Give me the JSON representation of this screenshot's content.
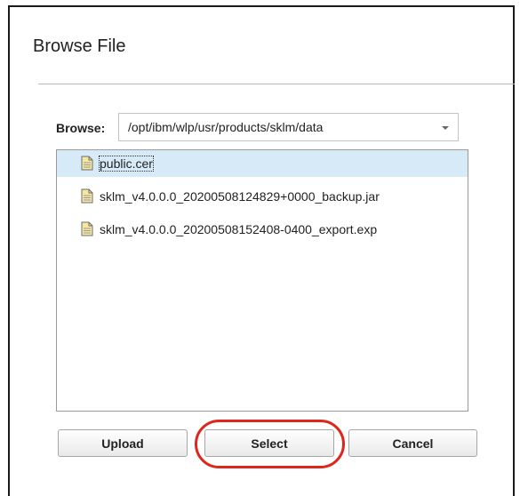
{
  "dialog": {
    "title": "Browse File",
    "browse_label": "Browse:",
    "browse_path": "/opt/ibm/wlp/usr/products/sklm/data",
    "files": [
      {
        "name": "public.cer",
        "selected": true
      },
      {
        "name": "sklm_v4.0.0.0_20200508124829+0000_backup.jar",
        "selected": false
      },
      {
        "name": "sklm_v4.0.0.0_20200508152408-0400_export.exp",
        "selected": false
      }
    ],
    "buttons": {
      "upload": "Upload",
      "select": "Select",
      "cancel": "Cancel"
    }
  },
  "icons": {
    "file": "document-icon",
    "dropdown": "chevron-down-icon"
  },
  "colors": {
    "selection": "#d7eaf7",
    "highlight_ring": "#e0251b",
    "file_icon_fill": "#f5e6a0"
  }
}
